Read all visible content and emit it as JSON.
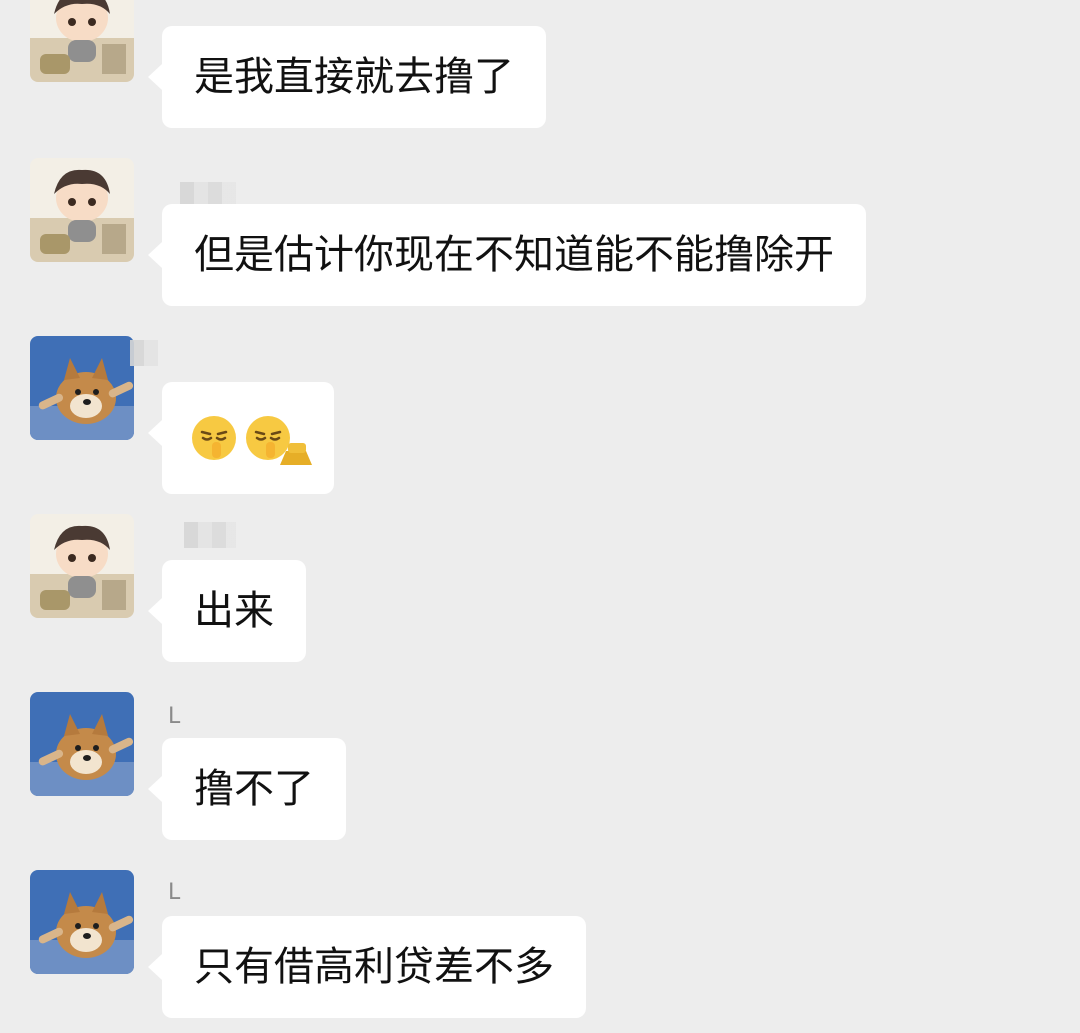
{
  "chat": {
    "messages": [
      {
        "sender": "boy",
        "text": "是我直接就去撸了"
      },
      {
        "sender": "boy",
        "text": "但是估计你现在不知道能不能撸除开"
      },
      {
        "sender": "dog",
        "emojis": [
          "pensive-shush-emoji",
          "pensive-shush-emoji"
        ]
      },
      {
        "sender": "boy",
        "text": "出来"
      },
      {
        "sender": "dog",
        "text": "撸不了",
        "name_mark": "L"
      },
      {
        "sender": "dog",
        "text": "只有借高利贷差不多",
        "name_mark": "L"
      }
    ]
  },
  "colors": {
    "background": "#ededed",
    "bubble": "#ffffff",
    "text": "#111111"
  }
}
